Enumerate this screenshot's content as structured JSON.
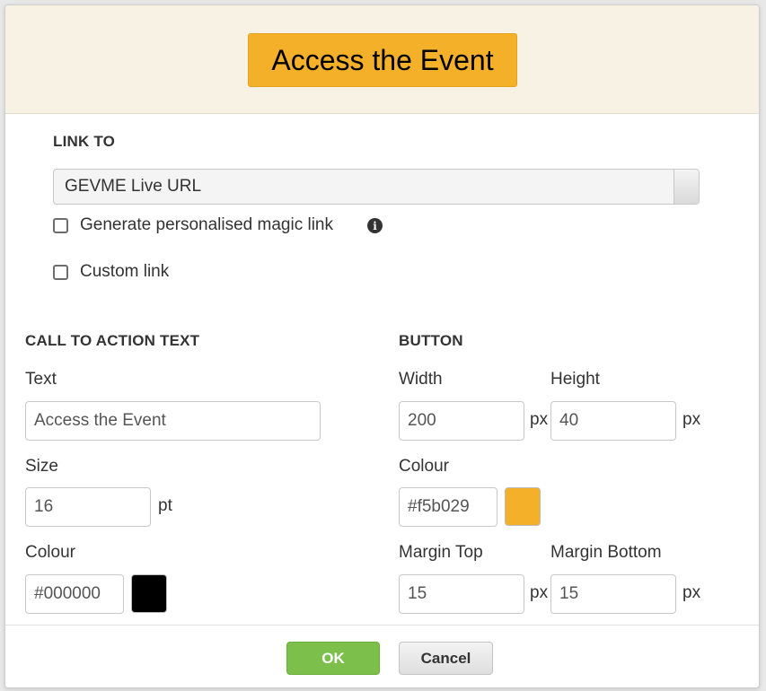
{
  "preview": {
    "button_text": "Access the Event",
    "button_color": "#f5b029",
    "background_color": "#f7f2e3"
  },
  "link_to": {
    "heading": "LINK TO",
    "selected": "GEVME Live URL",
    "magic_link_label": "Generate personalised magic link",
    "magic_link_checked": false,
    "custom_link_label": "Custom link",
    "custom_link_checked": false,
    "info_icon": "info-circle-icon"
  },
  "cta_text": {
    "heading": "CALL TO ACTION TEXT",
    "text_label": "Text",
    "text_value": "Access the Event",
    "size_label": "Size",
    "size_value": "16",
    "size_unit": "pt",
    "colour_label": "Colour",
    "colour_value": "#000000"
  },
  "button": {
    "heading": "BUTTON",
    "width_label": "Width",
    "width_value": "200",
    "height_label": "Height",
    "height_value": "40",
    "unit": "px",
    "colour_label": "Colour",
    "colour_value": "#f5b029",
    "margin_top_label": "Margin Top",
    "margin_top_value": "15",
    "margin_bottom_label": "Margin Bottom",
    "margin_bottom_value": "15"
  },
  "footer": {
    "ok_label": "OK",
    "cancel_label": "Cancel",
    "ok_color": "#7cc04b"
  }
}
